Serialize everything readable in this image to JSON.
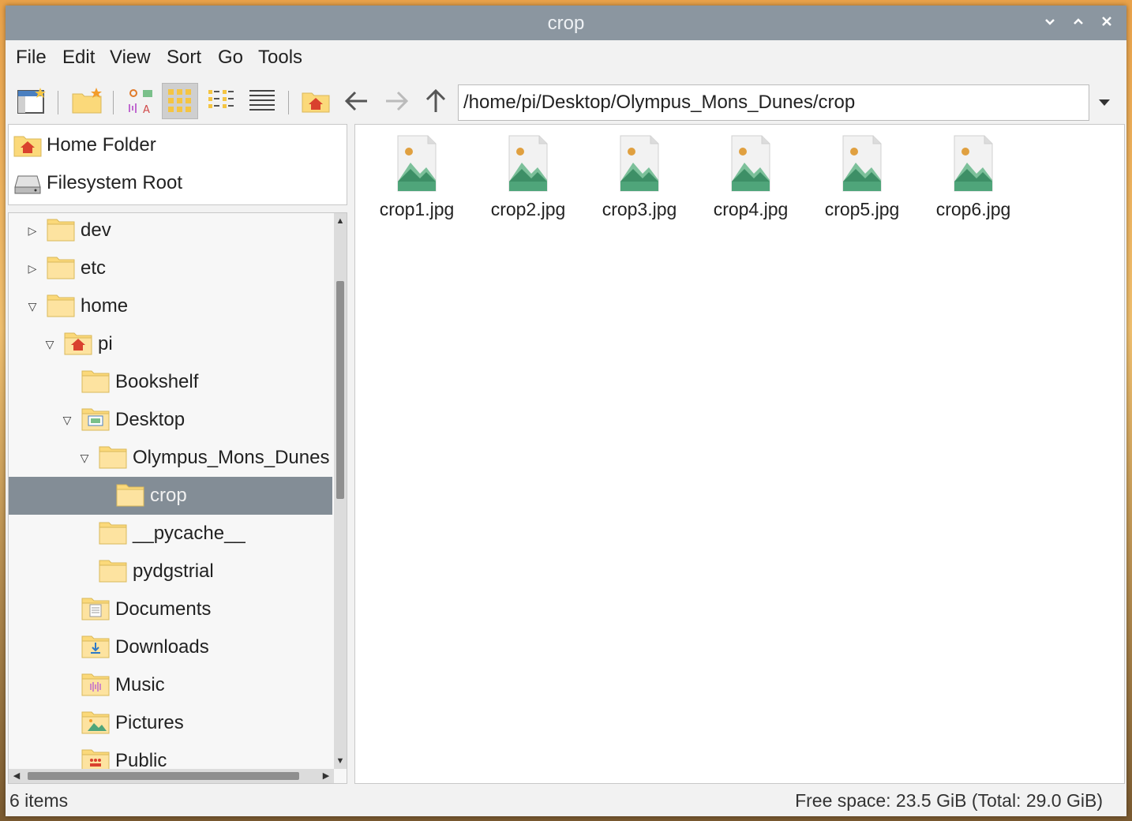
{
  "window": {
    "title": "crop"
  },
  "menu": [
    "File",
    "Edit",
    "View",
    "Sort",
    "Go",
    "Tools"
  ],
  "location": {
    "path": "/home/pi/Desktop/Olympus_Mons_Dunes/crop"
  },
  "places": [
    {
      "label": "Home Folder",
      "icon": "home-folder-icon"
    },
    {
      "label": "Filesystem Root",
      "icon": "drive-icon"
    }
  ],
  "tree": [
    {
      "label": "dev",
      "depth": 0,
      "expander": "collapsed",
      "icon": "folder-icon"
    },
    {
      "label": "etc",
      "depth": 0,
      "expander": "collapsed",
      "icon": "folder-icon"
    },
    {
      "label": "home",
      "depth": 0,
      "expander": "expanded",
      "icon": "folder-icon"
    },
    {
      "label": "pi",
      "depth": 1,
      "expander": "expanded",
      "icon": "home-folder-icon"
    },
    {
      "label": "Bookshelf",
      "depth": 2,
      "expander": "none",
      "icon": "folder-icon"
    },
    {
      "label": "Desktop",
      "depth": 2,
      "expander": "expanded",
      "icon": "desktop-folder-icon"
    },
    {
      "label": "Olympus_Mons_Dunes",
      "depth": 3,
      "expander": "expanded",
      "icon": "folder-icon"
    },
    {
      "label": "crop",
      "depth": 4,
      "expander": "none",
      "icon": "folder-icon",
      "selected": true
    },
    {
      "label": "__pycache__",
      "depth": 3,
      "expander": "none",
      "icon": "folder-icon"
    },
    {
      "label": "pydgstrial",
      "depth": 3,
      "expander": "none",
      "icon": "folder-icon"
    },
    {
      "label": "Documents",
      "depth": 2,
      "expander": "none",
      "icon": "documents-folder-icon"
    },
    {
      "label": "Downloads",
      "depth": 2,
      "expander": "none",
      "icon": "downloads-folder-icon"
    },
    {
      "label": "Music",
      "depth": 2,
      "expander": "none",
      "icon": "music-folder-icon"
    },
    {
      "label": "Pictures",
      "depth": 2,
      "expander": "none",
      "icon": "pictures-folder-icon"
    },
    {
      "label": "Public",
      "depth": 2,
      "expander": "none",
      "icon": "public-folder-icon"
    }
  ],
  "files": [
    {
      "name": "crop1.jpg",
      "icon": "image-file-icon"
    },
    {
      "name": "crop2.jpg",
      "icon": "image-file-icon"
    },
    {
      "name": "crop3.jpg",
      "icon": "image-file-icon"
    },
    {
      "name": "crop4.jpg",
      "icon": "image-file-icon"
    },
    {
      "name": "crop5.jpg",
      "icon": "image-file-icon"
    },
    {
      "name": "crop6.jpg",
      "icon": "image-file-icon"
    }
  ],
  "status": {
    "items": "6 items",
    "free_space": "Free space: 23.5 GiB (Total: 29.0 GiB)"
  },
  "colors": {
    "titlebar": "#8b96a0",
    "selection": "#838d96",
    "folder": "#fbd97a",
    "image_green": "#4fa57a"
  }
}
